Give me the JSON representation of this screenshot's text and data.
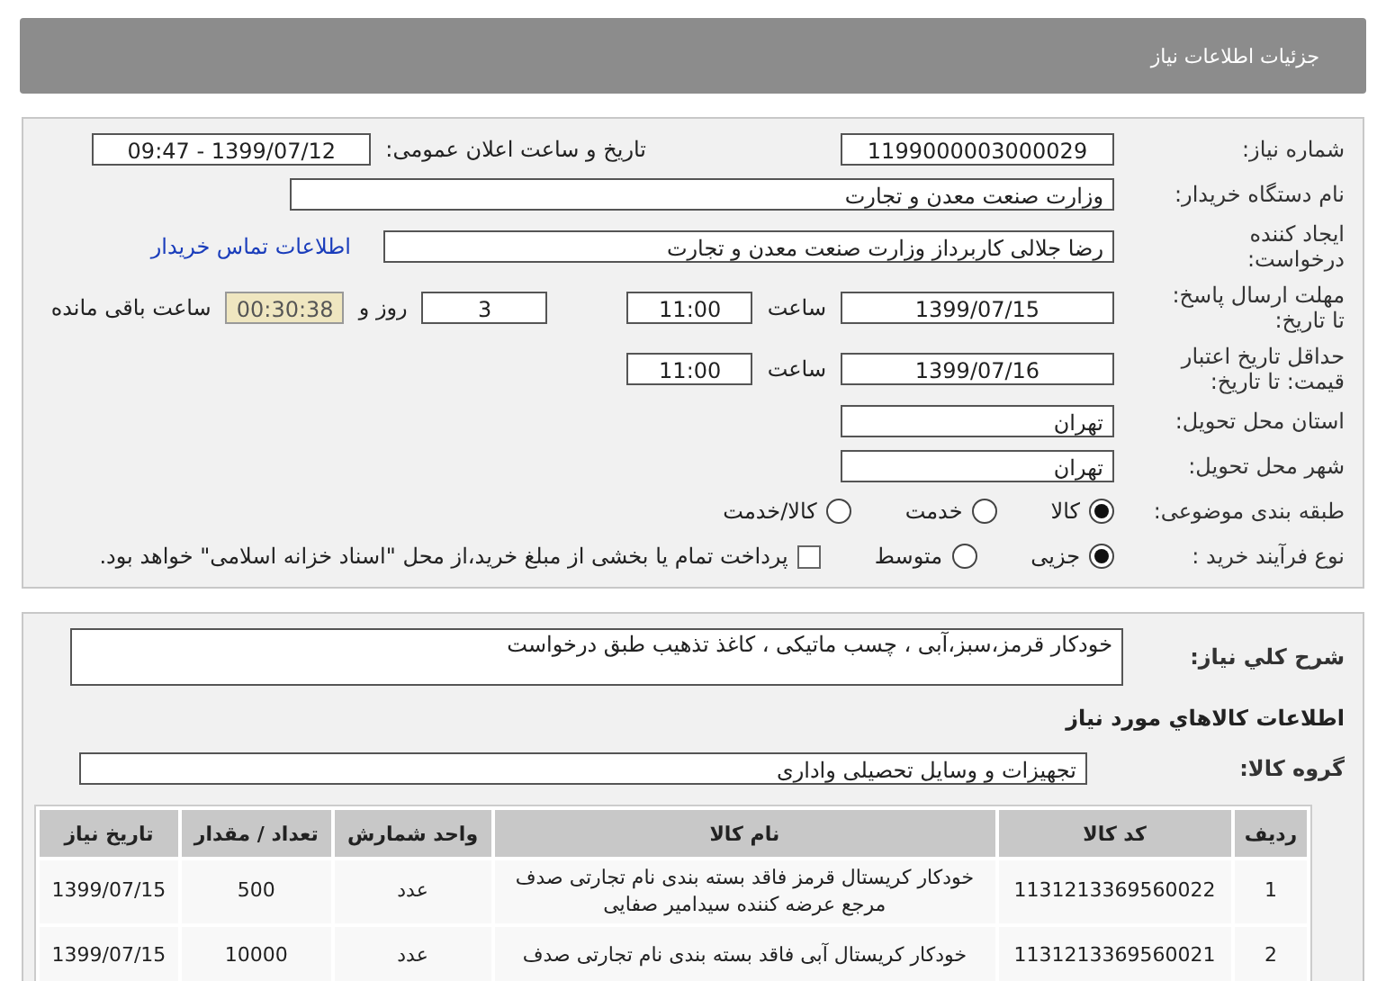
{
  "header": {
    "title": "جزئیات اطلاعات نیاز"
  },
  "details": {
    "need_number": {
      "label": "شماره نیاز:",
      "value": "1199000003000029"
    },
    "announce": {
      "label": "تاریخ و ساعت اعلان عمومی:",
      "value": "1399/07/12 - 09:47"
    },
    "buyer": {
      "label": "نام دستگاه خریدار:",
      "value": "وزارت صنعت معدن و تجارت"
    },
    "requester": {
      "label": "ایجاد کننده\nدرخواست:",
      "value": "رضا جلالی کاربرداز وزارت صنعت معدن و تجارت",
      "link": "اطلاعات تماس خریدار"
    },
    "deadline": {
      "label": "مهلت ارسال پاسخ:\nتا تاریخ:",
      "date": "1399/07/15",
      "time_label": "ساعت",
      "time": "11:00",
      "days": "3",
      "days_label": "روز و",
      "remaining": "00:30:38",
      "remaining_label": "ساعت باقی مانده"
    },
    "validity": {
      "label": "حداقل تاریخ اعتبار\nقیمت: تا تاریخ:",
      "date": "1399/07/16",
      "time_label": "ساعت",
      "time": "11:00"
    },
    "province": {
      "label": "استان محل تحویل:",
      "value": "تهران"
    },
    "city": {
      "label": "شهر محل تحویل:",
      "value": "تهران"
    },
    "category": {
      "label": "طبقه بندی موضوعی:",
      "options": [
        {
          "label": "کالا",
          "selected": true
        },
        {
          "label": "خدمت",
          "selected": false
        },
        {
          "label": "کالا/خدمت",
          "selected": false
        }
      ]
    },
    "purchase_type": {
      "label": "نوع فرآیند خرید :",
      "options": [
        {
          "label": "جزیی",
          "selected": true
        },
        {
          "label": "متوسط",
          "selected": false
        }
      ],
      "payment": {
        "label": "پرداخت تمام یا بخشی از مبلغ خرید،از محل \"اسناد خزانه اسلامی\" خواهد بود.",
        "checked": false
      }
    }
  },
  "goods": {
    "description": {
      "label": "شرح کلي نياز:",
      "value": "خودکار قرمز،سبز،آبی ، چسب ماتیکی ، کاغذ تذهیب طبق درخواست"
    },
    "section_title": "اطلاعات کالاهاي مورد نياز",
    "group": {
      "label": "گروه کالا:",
      "value": "تجهیزات و وسایل تحصیلی واداری"
    },
    "table": {
      "columns": [
        "ردیف",
        "کد کالا",
        "نام کالا",
        "واحد شمارش",
        "تعداد / مقدار",
        "تاریخ نیاز"
      ],
      "rows": [
        [
          "1",
          "1131213369560022",
          "خودکار کریستال قرمز فاقد بسته بندی نام تجارتی صدف مرجع عرضه کننده سیدامیر صفایی",
          "عدد",
          "500",
          "1399/07/15"
        ],
        [
          "2",
          "1131213369560021",
          "خودکار کریستال آبی فاقد بسته بندی نام تجارتی صدف",
          "عدد",
          "10000",
          "1399/07/15"
        ]
      ]
    }
  }
}
